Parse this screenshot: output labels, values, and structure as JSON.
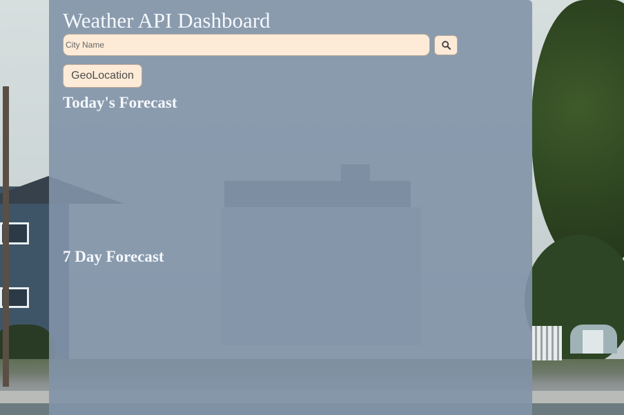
{
  "header": {
    "title": "Weather API Dashboard"
  },
  "search": {
    "placeholder": "City Name",
    "value": "",
    "button_icon": "search-icon"
  },
  "geolocation": {
    "button_label": "GeoLocation"
  },
  "sections": {
    "today_heading": "Today's Forecast",
    "week_heading": "7 Day Forecast"
  },
  "colors": {
    "panel": "#8294a8",
    "input_background": "#fdebd7",
    "heading_text": "#f4f7fb"
  }
}
